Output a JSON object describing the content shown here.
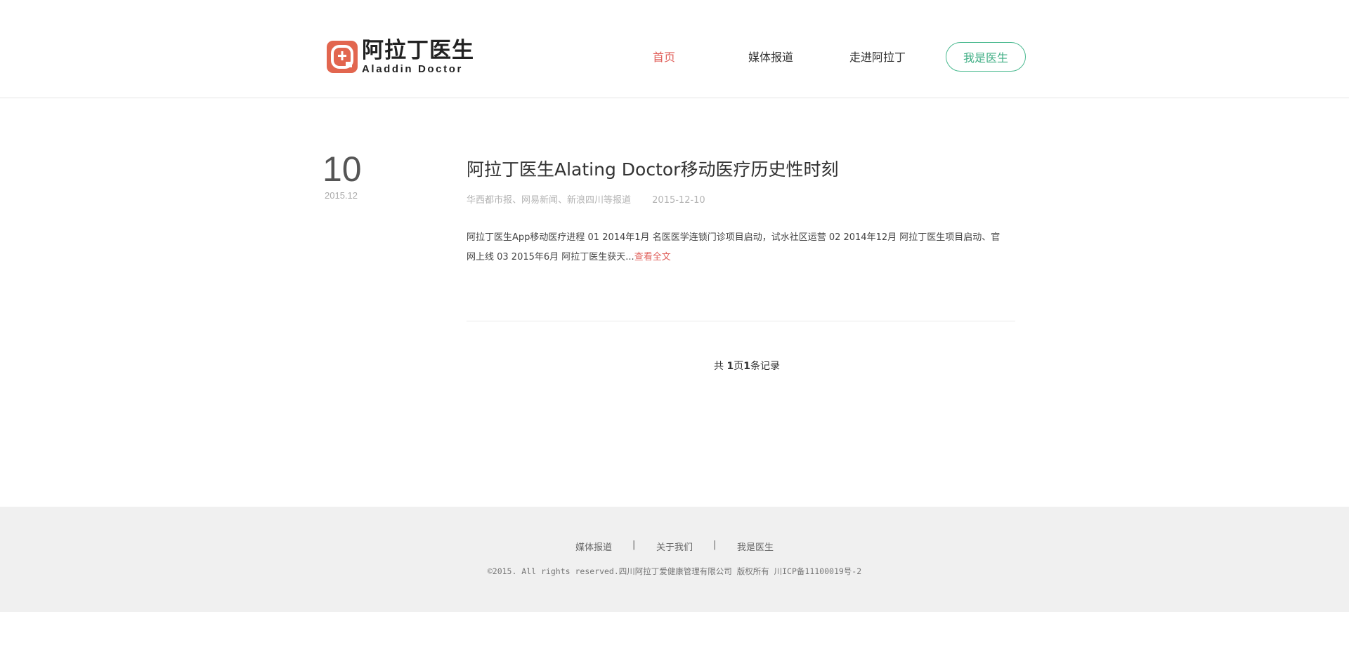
{
  "header": {
    "logo": {
      "name_cn": "阿拉丁医生",
      "name_en": "Aladdin Doctor"
    },
    "nav": [
      {
        "label": "首页",
        "active": true
      },
      {
        "label": "媒体报道",
        "active": false
      },
      {
        "label": "走进阿拉丁",
        "active": false
      }
    ],
    "doctor_button": "我是医生"
  },
  "article": {
    "day": "10",
    "year_month": "2015.12",
    "title": "阿拉丁医生Alating Doctor移动医疗历史性时刻",
    "sources": "华西都市报、网易新闻、新浪四川等报道",
    "date": "2015-12-10",
    "summary": "阿拉丁医生App移动医疗进程 01 2014年1月 名医医学连锁门诊项目启动，试水社区运营 02 2014年12月 阿拉丁医生项目启动、官网上线 03 2015年6月 阿拉丁医生获天...",
    "read_more": "查看全文"
  },
  "pagination": {
    "prefix": "共 ",
    "pages": "1",
    "pages_unit": "页",
    "records": "1",
    "records_unit": "条记录"
  },
  "footer": {
    "links": [
      "媒体报道",
      "关于我们",
      "我是医生"
    ],
    "separator": "|",
    "copyright": "©2015. All rights reserved.四川阿拉丁爱健康管理有限公司 版权所有 川ICP备11100019号-2"
  },
  "colors": {
    "accent_red": "#e05f5a",
    "accent_green": "#3fae84",
    "logo_red": "#e2664f",
    "footer_bg": "#f0f0f0"
  }
}
